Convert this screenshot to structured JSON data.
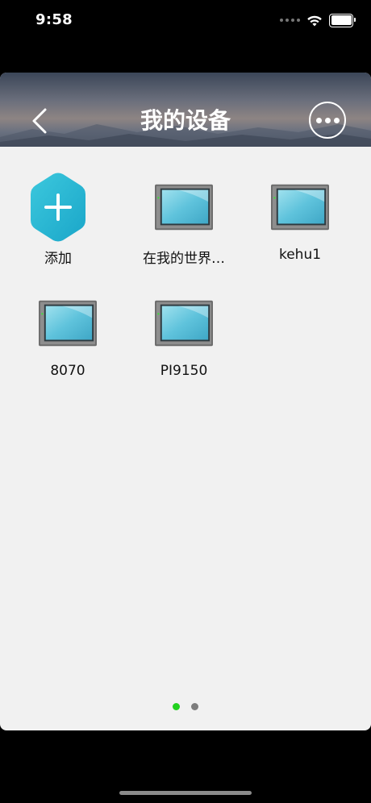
{
  "status_bar": {
    "time": "9:58"
  },
  "header": {
    "title": "我的设备",
    "back_icon": "chevron-left-icon",
    "more_icon": "more-horizontal-icon"
  },
  "devices": [
    {
      "label": "添加",
      "icon": "add-icon"
    },
    {
      "label": "在我的世界…",
      "icon": "monitor-icon"
    },
    {
      "label": "kehu1",
      "icon": "monitor-icon"
    },
    {
      "label": "8070",
      "icon": "monitor-icon"
    },
    {
      "label": "PI9150",
      "icon": "monitor-icon"
    }
  ],
  "pagination": {
    "pages": 2,
    "current": 1,
    "active_color": "#22d11f",
    "inactive_color": "#7d7d7d"
  },
  "colors": {
    "header_text": "#ffffff",
    "background": "#f1f1f1",
    "add_button": "#24b3cf"
  }
}
